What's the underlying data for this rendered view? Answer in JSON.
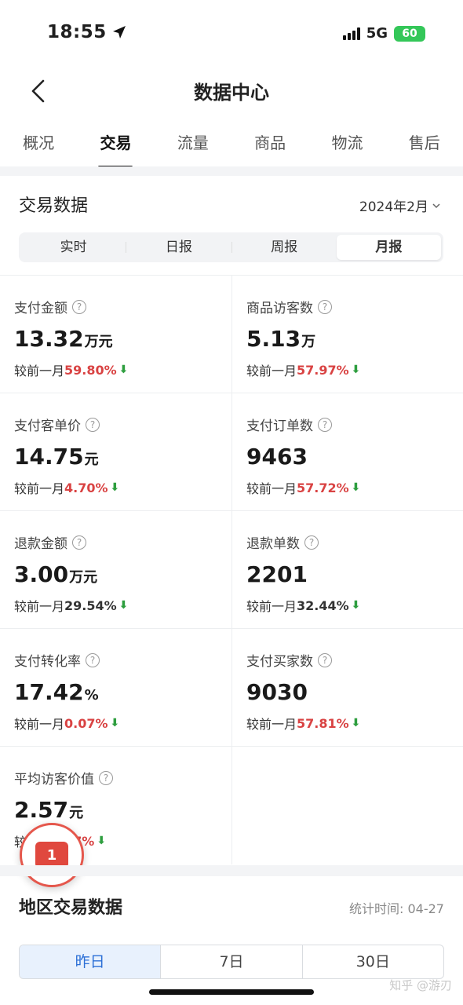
{
  "status": {
    "time": "18:55",
    "network": "5G",
    "battery": "60"
  },
  "nav": {
    "title": "数据中心"
  },
  "tabs": [
    "概况",
    "交易",
    "流量",
    "商品",
    "物流",
    "售后"
  ],
  "section": {
    "title": "交易数据",
    "date": "2024年2月"
  },
  "period_segment": [
    "实时",
    "日报",
    "周报",
    "月报"
  ],
  "compare_prefix": "较前一月",
  "metrics": [
    {
      "label": "支付金额",
      "value": "13.32",
      "unit": "万元",
      "pct": "59.80%",
      "pct_color": "red"
    },
    {
      "label": "商品访客数",
      "value": "5.13",
      "unit": "万",
      "pct": "57.97%",
      "pct_color": "red"
    },
    {
      "label": "支付客单价",
      "value": "14.75",
      "unit": "元",
      "pct": "4.70%",
      "pct_color": "red"
    },
    {
      "label": "支付订单数",
      "value": "9463",
      "unit": "",
      "pct": "57.72%",
      "pct_color": "red"
    },
    {
      "label": "退款金额",
      "value": "3.00",
      "unit": "万元",
      "pct": "29.54%",
      "pct_color": "dark"
    },
    {
      "label": "退款单数",
      "value": "2201",
      "unit": "",
      "pct": "32.44%",
      "pct_color": "dark"
    },
    {
      "label": "支付转化率",
      "value": "17.42",
      "unit": "%",
      "pct": "0.07%",
      "pct_color": "red"
    },
    {
      "label": "支付买家数",
      "value": "9030",
      "unit": "",
      "pct": "57.81%",
      "pct_color": "red"
    },
    {
      "label": "平均访客价值",
      "value": "2.57",
      "unit": "元",
      "pct": "77%",
      "pct_color": "red"
    }
  ],
  "float_badge": {
    "count": "1"
  },
  "region": {
    "title": "地区交易数据",
    "stat_time": "统计时间: 04-27",
    "tabs": [
      "昨日",
      "7日",
      "30日"
    ]
  },
  "watermark": "知乎 @游刃",
  "colors": {
    "accent_red": "#d94343",
    "down_green": "#2e9e3f",
    "active_blue": "#2b6fd6"
  }
}
